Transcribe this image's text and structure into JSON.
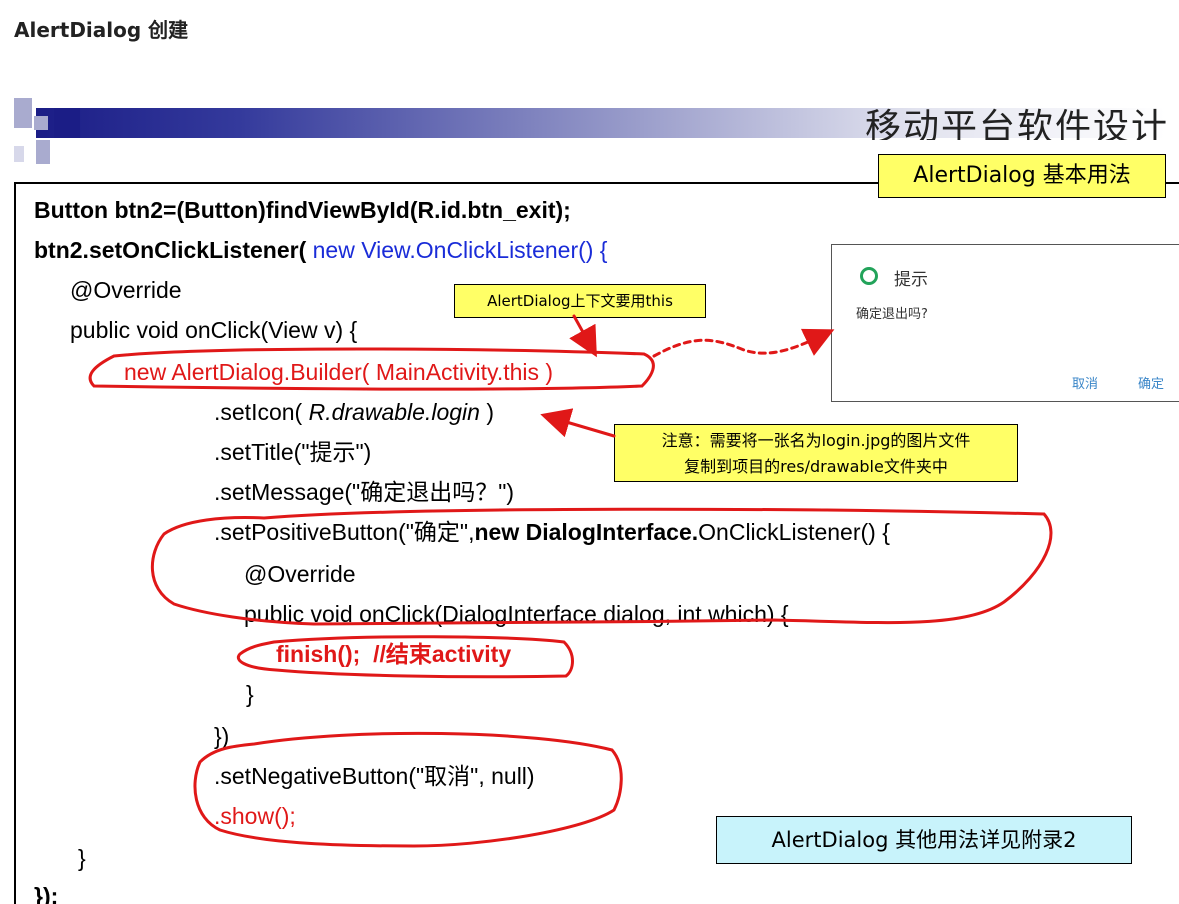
{
  "heading": "AlertDialog 创建",
  "slide": {
    "subtitle": "移动平台软件设计",
    "title_box": "AlertDialog 基本用法",
    "other_box": "AlertDialog 其他用法详见附录2",
    "note_this": "AlertDialog上下文要用this",
    "note_file_line1": "注意：需要将一张名为login.jpg的图片文件",
    "note_file_line2": "复制到项目的res/drawable文件夹中"
  },
  "code": {
    "l1": "Button btn2=(Button)findViewById(R.id.btn_exit);",
    "l2a": "btn2.setOnClickListener( ",
    "l2b": "new View.OnClickListener() {",
    "l3": "@Override",
    "l4": "public void onClick(View v) {",
    "l5": "new AlertDialog.Builder( MainActivity.this )",
    "l6a": ".setIcon( ",
    "l6b": "R.drawable.login",
    "l6c": " )",
    "l7": ".setTitle(\"提示\")",
    "l8": ".setMessage(\"确定退出吗？\")",
    "l9a": ".setPositiveButton(\"确定\",",
    "l9b": "new DialogInterface.",
    "l9c": "OnClickListener() {",
    "l10": "@Override",
    "l11": "public void onClick(DialogInterface dialog, int which) {",
    "l12": "finish();  //结束activity",
    "l13": "}",
    "l14": "})",
    "l15": ".setNegativeButton(\"取消\", null)",
    "l16": ".show();",
    "l17": "}",
    "l18": "});"
  },
  "dialog": {
    "title": "提示",
    "message": "确定退出吗?",
    "negative": "取消",
    "positive": "确定"
  },
  "colors": {
    "annotation_red": "#e01818",
    "code_blue": "#1a2cd8",
    "note_yellow": "#ffff66",
    "info_cyan": "#c8f3fb"
  }
}
